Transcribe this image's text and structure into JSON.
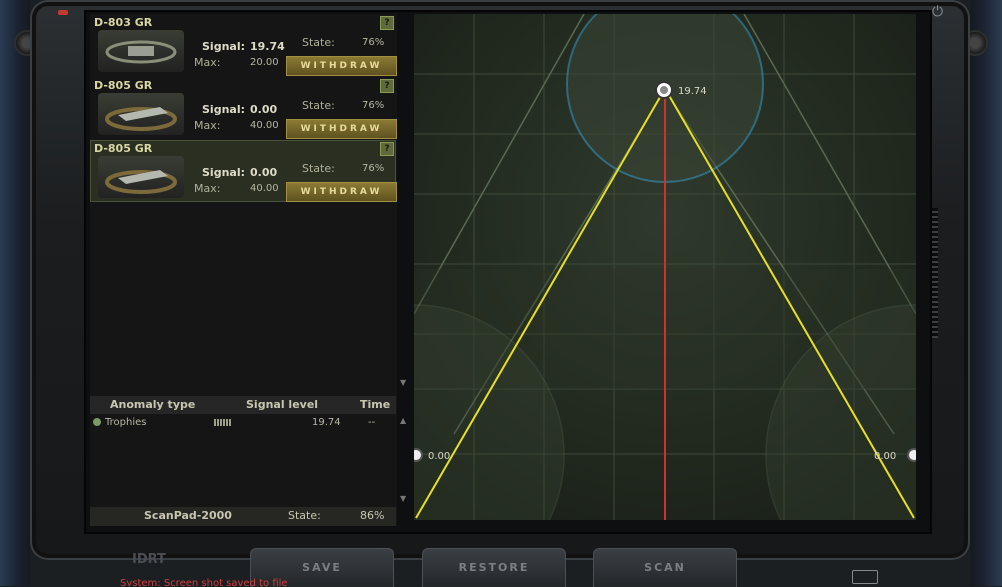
{
  "drones": [
    {
      "name": "D-803 GR",
      "signal_label": "Signal:",
      "signal": "19.74",
      "max_label": "Max:",
      "max": "20.00",
      "state_label": "State:",
      "state": "76%",
      "button": "WITHDRAW"
    },
    {
      "name": "D-805 GR",
      "signal_label": "Signal:",
      "signal": "0.00",
      "max_label": "Max:",
      "max": "40.00",
      "state_label": "State:",
      "state": "76%",
      "button": "WITHDRAW"
    },
    {
      "name": "D-805 GR",
      "signal_label": "Signal:",
      "signal": "0.00",
      "max_label": "Max:",
      "max": "40.00",
      "state_label": "State:",
      "state": "76%",
      "button": "WITHDRAW"
    }
  ],
  "help_label": "?",
  "anomaly_table": {
    "headers": [
      "Anomaly type",
      "Signal level",
      "Time"
    ],
    "rows": [
      {
        "type": "Trophies",
        "level": "19.74",
        "time": "--"
      }
    ]
  },
  "device": {
    "name": "ScanPad-2000",
    "state_label": "State:",
    "state": "86%"
  },
  "radar": {
    "top_value": "19.74",
    "left_value": "0.00",
    "right_value": "0.00"
  },
  "buttons": {
    "save": "SAVE",
    "restore": "RESTORE",
    "scan": "SCAN"
  },
  "logo": "IDRT",
  "status_message": "System: Screen shot saved to file",
  "colors": {
    "accent": "#a09040",
    "radar_line": "#e6e020",
    "circle": "#3aa4d8",
    "center_line": "#d03030"
  }
}
